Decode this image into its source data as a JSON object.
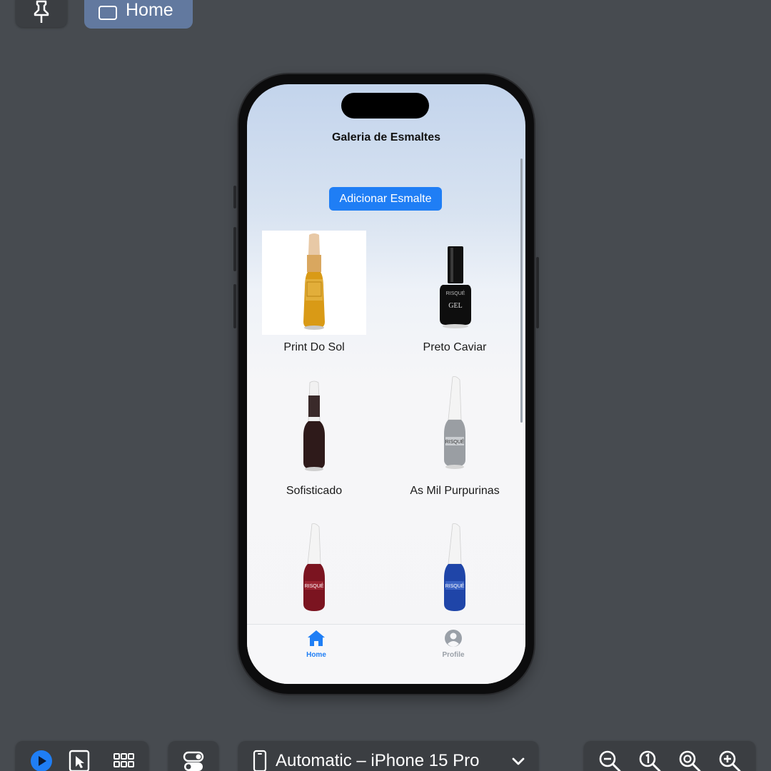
{
  "toolbar": {
    "pin_icon": "pin-icon",
    "home_tab_label": "Home"
  },
  "app": {
    "nav_title": "Galeria de Esmaltes",
    "add_button_label": "Adicionar Esmalte",
    "polishes": [
      {
        "name": "Print Do Sol",
        "color": "#d99a16"
      },
      {
        "name": "Preto Caviar",
        "color": "#0e0e0e"
      },
      {
        "name": "Sofisticado",
        "color": "#2e1a1a"
      },
      {
        "name": "As Mil Purpurinas",
        "color": "#9a9ea3"
      },
      {
        "name": "",
        "color": "#7b1420"
      },
      {
        "name": "",
        "color": "#1f45a8"
      }
    ],
    "tabs": [
      {
        "label": "Home",
        "icon": "house-icon",
        "active": true
      },
      {
        "label": "Profile",
        "icon": "person-circle-icon",
        "active": false
      }
    ]
  },
  "bottom_bar": {
    "device_selector": "Automatic – iPhone 15 Pro"
  },
  "colors": {
    "accent": "#1f7ef5",
    "canvas_bg": "#474b50"
  }
}
